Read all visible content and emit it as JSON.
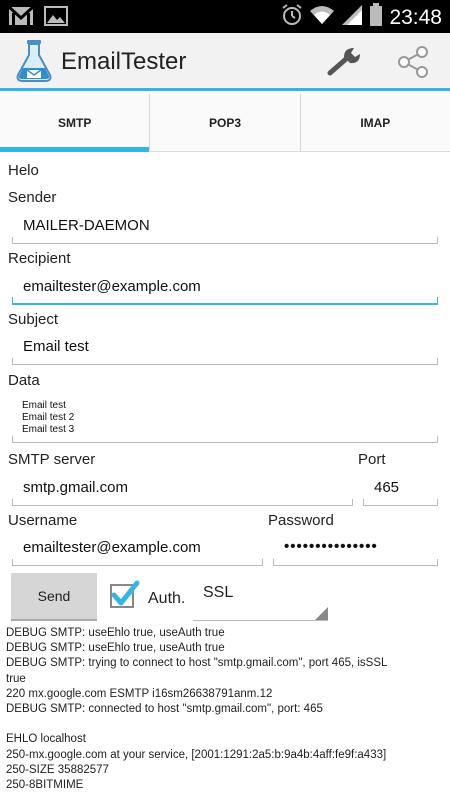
{
  "status_bar": {
    "time": "23:48",
    "icons": [
      "gmail-icon",
      "gallery-icon",
      "alarm-icon",
      "wifi-icon",
      "signal-icon",
      "battery-icon"
    ]
  },
  "action_bar": {
    "title": "EmailTester",
    "accent": "#33b5e5"
  },
  "tabs": [
    {
      "label": "SMTP",
      "active": true
    },
    {
      "label": "POP3",
      "active": false
    },
    {
      "label": "IMAP",
      "active": false
    }
  ],
  "form": {
    "helo_label": "Helo",
    "sender_label": "Sender",
    "sender_value": "MAILER-DAEMON",
    "recipient_label": "Recipient",
    "recipient_value": "emailtester@example.com",
    "subject_label": "Subject",
    "subject_value": "Email test",
    "data_label": "Data",
    "data_lines": [
      "Email test",
      "Email test 2",
      "Email test 3"
    ],
    "smtp_server_label": "SMTP server",
    "smtp_server_value": "smtp.gmail.com",
    "port_label": "Port",
    "port_value": "465",
    "username_label": "Username",
    "username_value": "emailtester@example.com",
    "password_label": "Password",
    "password_value": "•••••••••••••••",
    "send_label": "Send",
    "auth_label": "Auth.",
    "auth_checked": true,
    "security_value": "SSL"
  },
  "log": [
    "DEBUG SMTP: useEhlo true, useAuth true",
    "DEBUG SMTP: useEhlo true, useAuth true",
    "DEBUG SMTP: trying to connect to host \"smtp.gmail.com\", port 465, isSSL",
    "true",
    "220 mx.google.com ESMTP i16sm26638791anm.12",
    "DEBUG SMTP: connected to host \"smtp.gmail.com\", port: 465",
    "",
    "EHLO localhost",
    "250-mx.google.com at your service, [2001:1291:2a5:b:9a4b:4aff:fe9f:a433]",
    "250-SIZE 35882577",
    "250-8BITMIME"
  ]
}
